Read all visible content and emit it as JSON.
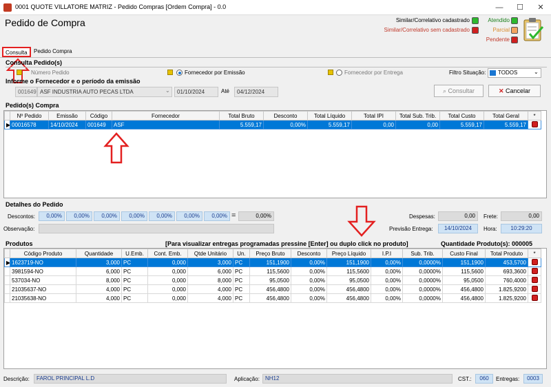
{
  "window": {
    "title": "0001 QUOTE VILLATORE MATRIZ - Pedido Compras [Ordem Compra] - 0.0",
    "btn_min": "—",
    "btn_max": "☐",
    "btn_close": "✕"
  },
  "header": {
    "page_title": "Pedido de Compra",
    "legend_similar": "Similar/Correlativo cadastrado",
    "legend_similar_sem": "Similar/Correlativo sem cadastrado",
    "legend_atendido": "Atendido",
    "legend_parcial": "Parcial",
    "legend_pendente": "Pendente",
    "colors": {
      "green": "#2eb82e",
      "orange": "#f4a460",
      "red": "#d01f1f"
    }
  },
  "tabs": [
    {
      "label": "Consulta"
    },
    {
      "label": "Pedido Compra"
    }
  ],
  "consulta": {
    "section_title": "Consulta Pedido(s)",
    "radio_numero": "Número Pedido",
    "radio_emissao": "Fornecedor por Emissão",
    "radio_entrega": "Fornecedor por Entrega",
    "filtro_label": "Filtro Situação:",
    "filtro_value": "TODOS",
    "informe_label": "Informe o Fornecedor e o período da emissão",
    "fornecedor_code": "001649",
    "fornecedor_name": "ASF INDUSTRIA AUTO PECAS LTDA",
    "date_from": "01/10/2024",
    "ate_label": "Até",
    "date_to": "04/12/2024",
    "btn_consultar": "Consultar",
    "btn_cancelar": "Cancelar"
  },
  "pedidos": {
    "section_title": "Pedido(s) Compra",
    "columns": [
      "Nº Pedido",
      "Emissão",
      "Código",
      "Fornecedor",
      "Total Bruto",
      "Desconto",
      "Total Líquido",
      "Total IPI",
      "Total Sub. Trib.",
      "Total Custo",
      "Total Geral",
      "*"
    ],
    "rows": [
      {
        "numero": "00016578",
        "emissao": "14/10/2024",
        "codigo": "001649",
        "fornecedor": "ASF",
        "total_bruto": "5.559,17",
        "desconto": "0,00%",
        "total_liquido": "5.559,17",
        "total_ipi": "0,00",
        "total_sub_trib": "0,00",
        "total_custo": "5.559,17",
        "total_geral": "5.559,17"
      }
    ]
  },
  "detalhes": {
    "section_title": "Detalhes do Pedido",
    "descontos_label": "Descontos:",
    "descontos": [
      "0,00%",
      "0,00%",
      "0,00%",
      "0,00%",
      "0,00%",
      "0,00%",
      "0,00%"
    ],
    "equals": "=",
    "descontos_total": "0,00%",
    "despesas_label": "Despesas:",
    "despesas_value": "0,00",
    "frete_label": "Frete:",
    "frete_value": "0,00",
    "observacao_label": "Observação:",
    "previsao_label": "Previsão Entrega:",
    "previsao_value": "14/10/2024",
    "hora_label": "Hora:",
    "hora_value": "10:29:20"
  },
  "produtos": {
    "section_title": "Produtos",
    "hint": "[Para visualizar entregas programadas pressine [Enter] ou duplo click no produto]",
    "qtde_label": "Quantidade Produto(s): 000005",
    "columns": [
      "Código Produto",
      "Quantidade",
      "U.Emb.",
      "Cont. Emb.",
      "Qtde Unitário",
      "Un.",
      "Preço Bruto",
      "Desconto",
      "Preço Líquido",
      "I.P.I",
      "Sub. Trib.",
      "Custo Final",
      "Total Produto",
      "*"
    ],
    "rows": [
      {
        "codigo": "1623719-NO",
        "quantidade": "3,000",
        "uemb": "PC",
        "cont": "0,000",
        "qtde_unit": "3,000",
        "un": "PC",
        "preco_bruto": "151,1900",
        "desconto": "0,00%",
        "preco_liquido": "151,1900",
        "ipi": "0,00%",
        "sub_trib": "0,0000%",
        "custo_final": "151,1900",
        "total_produto": "453,5700"
      },
      {
        "codigo": "3981594-NO",
        "quantidade": "6,000",
        "uemb": "PC",
        "cont": "0,000",
        "qtde_unit": "6,000",
        "un": "PC",
        "preco_bruto": "115,5600",
        "desconto": "0,00%",
        "preco_liquido": "115,5600",
        "ipi": "0,00%",
        "sub_trib": "0,0000%",
        "custo_final": "115,5600",
        "total_produto": "693,3600"
      },
      {
        "codigo": "537034-NO",
        "quantidade": "8,000",
        "uemb": "PC",
        "cont": "0,000",
        "qtde_unit": "8,000",
        "un": "PC",
        "preco_bruto": "95,0500",
        "desconto": "0,00%",
        "preco_liquido": "95,0500",
        "ipi": "0,00%",
        "sub_trib": "0,0000%",
        "custo_final": "95,0500",
        "total_produto": "760,4000"
      },
      {
        "codigo": "21035637-NO",
        "quantidade": "4,000",
        "uemb": "PC",
        "cont": "0,000",
        "qtde_unit": "4,000",
        "un": "PC",
        "preco_bruto": "456,4800",
        "desconto": "0,00%",
        "preco_liquido": "456,4800",
        "ipi": "0,00%",
        "sub_trib": "0,0000%",
        "custo_final": "456,4800",
        "total_produto": "1.825,9200"
      },
      {
        "codigo": "21035638-NO",
        "quantidade": "4,000",
        "uemb": "PC",
        "cont": "0,000",
        "qtde_unit": "4,000",
        "un": "PC",
        "preco_bruto": "456,4800",
        "desconto": "0,00%",
        "preco_liquido": "456,4800",
        "ipi": "0,00%",
        "sub_trib": "0,0000%",
        "custo_final": "456,4800",
        "total_produto": "1.825,9200"
      }
    ]
  },
  "footer": {
    "descricao_label": "Descrição:",
    "descricao_value": "FAROL PRINCIPAL L.D",
    "aplicacao_label": "Aplicação:",
    "aplicacao_value": "NH12",
    "cst_label": "CST.:",
    "cst_value": "060",
    "entregas_label": "Entregas:",
    "entregas_value": "0003"
  }
}
